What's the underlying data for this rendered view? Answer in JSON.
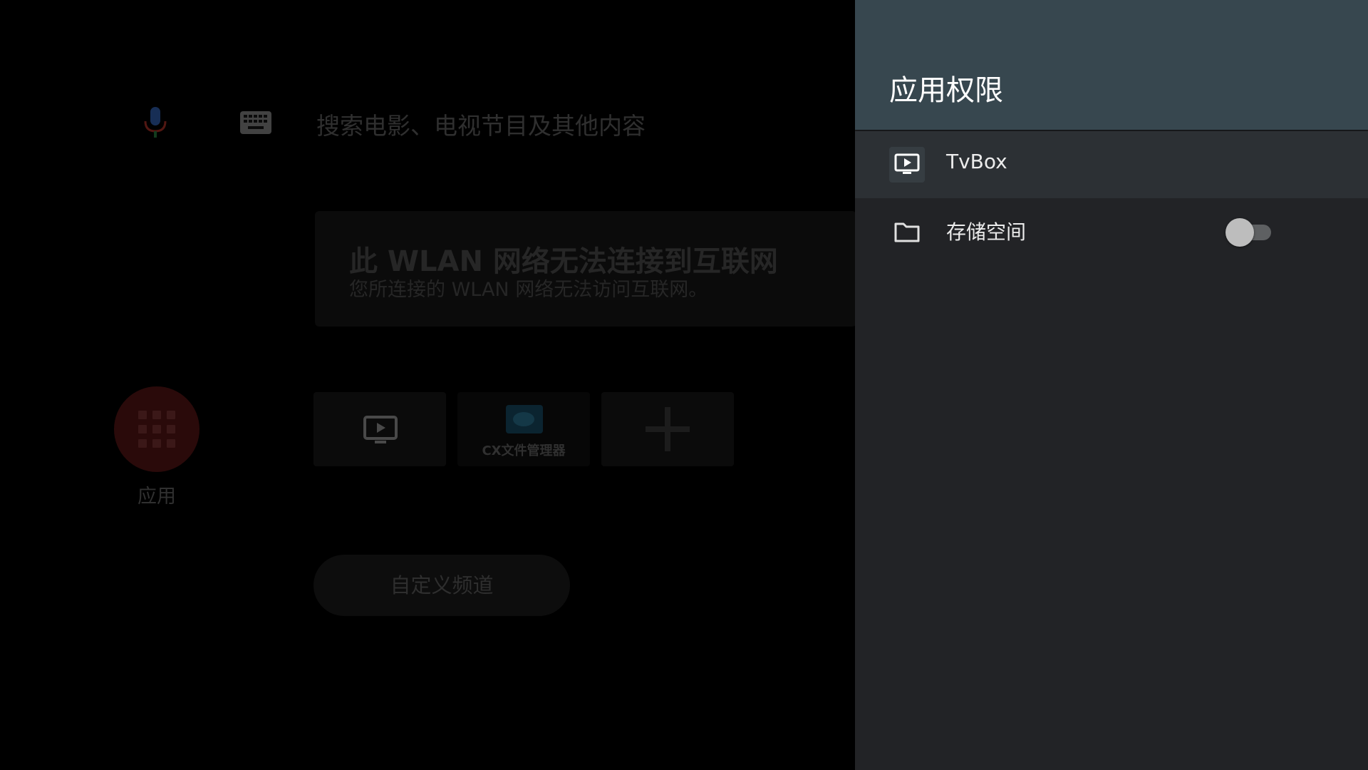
{
  "launcher": {
    "search_placeholder": "搜索电影、电视节目及其他内容",
    "icons": {
      "mic": "mic-icon",
      "keyboard": "keyboard-icon"
    },
    "network_card": {
      "title": "此 WLAN 网络无法连接到互联网",
      "subtitle": "您所连接的 WLAN 网络无法访问互联网。"
    },
    "apps_button": {
      "label": "应用",
      "icon": "apps-grid-icon",
      "color": "#2a0a0a"
    },
    "app_tiles": [
      {
        "icon": "tv-play-icon",
        "label": ""
      },
      {
        "icon": "cx-folder-icon",
        "label": "CX文件管理器"
      },
      {
        "icon": "plus-icon",
        "label": ""
      }
    ],
    "custom_channel_label": "自定义频道"
  },
  "panel": {
    "title": "应用权限",
    "header_color": "#37474f",
    "background_color": "#222326",
    "items": [
      {
        "icon": "tv-play-icon",
        "label": "TvBox",
        "focused": true
      },
      {
        "icon": "folder-icon",
        "label": "存储空间",
        "toggle": {
          "state": "off"
        }
      }
    ]
  }
}
